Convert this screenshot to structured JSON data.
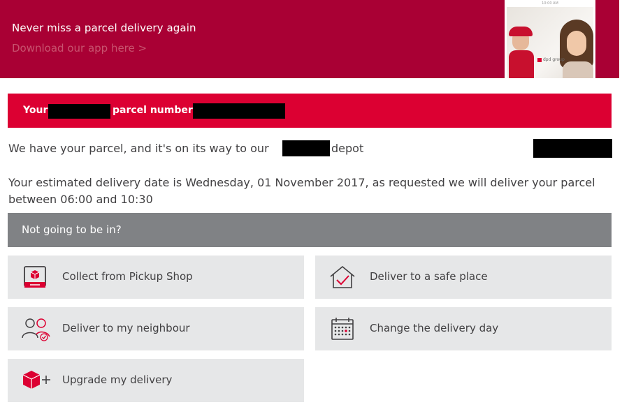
{
  "banner": {
    "title": "Never miss a parcel delivery again",
    "link": "Download our app here >",
    "phone_logo": "dpd group",
    "phone_status": "10:00 AM"
  },
  "parcel_header": {
    "prefix": "Your",
    "middle": "parcel number"
  },
  "status": {
    "part1": "We have your parcel, and it's on its way to our",
    "part2": "depot"
  },
  "estimate": {
    "text": "Your estimated delivery date is Wednesday, 01 November 2017, as requested we will deliver your parcel between 06:00 and 10:30"
  },
  "not_in": {
    "label": "Not going to be in?"
  },
  "options": [
    {
      "label": "Collect from Pickup Shop",
      "icon": "pickup-shop-icon"
    },
    {
      "label": "Deliver to a safe place",
      "icon": "safe-place-icon"
    },
    {
      "label": "Deliver to my neighbour",
      "icon": "neighbour-icon"
    },
    {
      "label": "Change the delivery day",
      "icon": "calendar-icon"
    },
    {
      "label": "Upgrade my delivery",
      "icon": "upgrade-icon"
    }
  ],
  "colors": {
    "banner": "#a90034",
    "brand_red": "#dc0032",
    "grey_bar": "#808285",
    "option_bg": "#e6e7e8",
    "text": "#414042"
  }
}
